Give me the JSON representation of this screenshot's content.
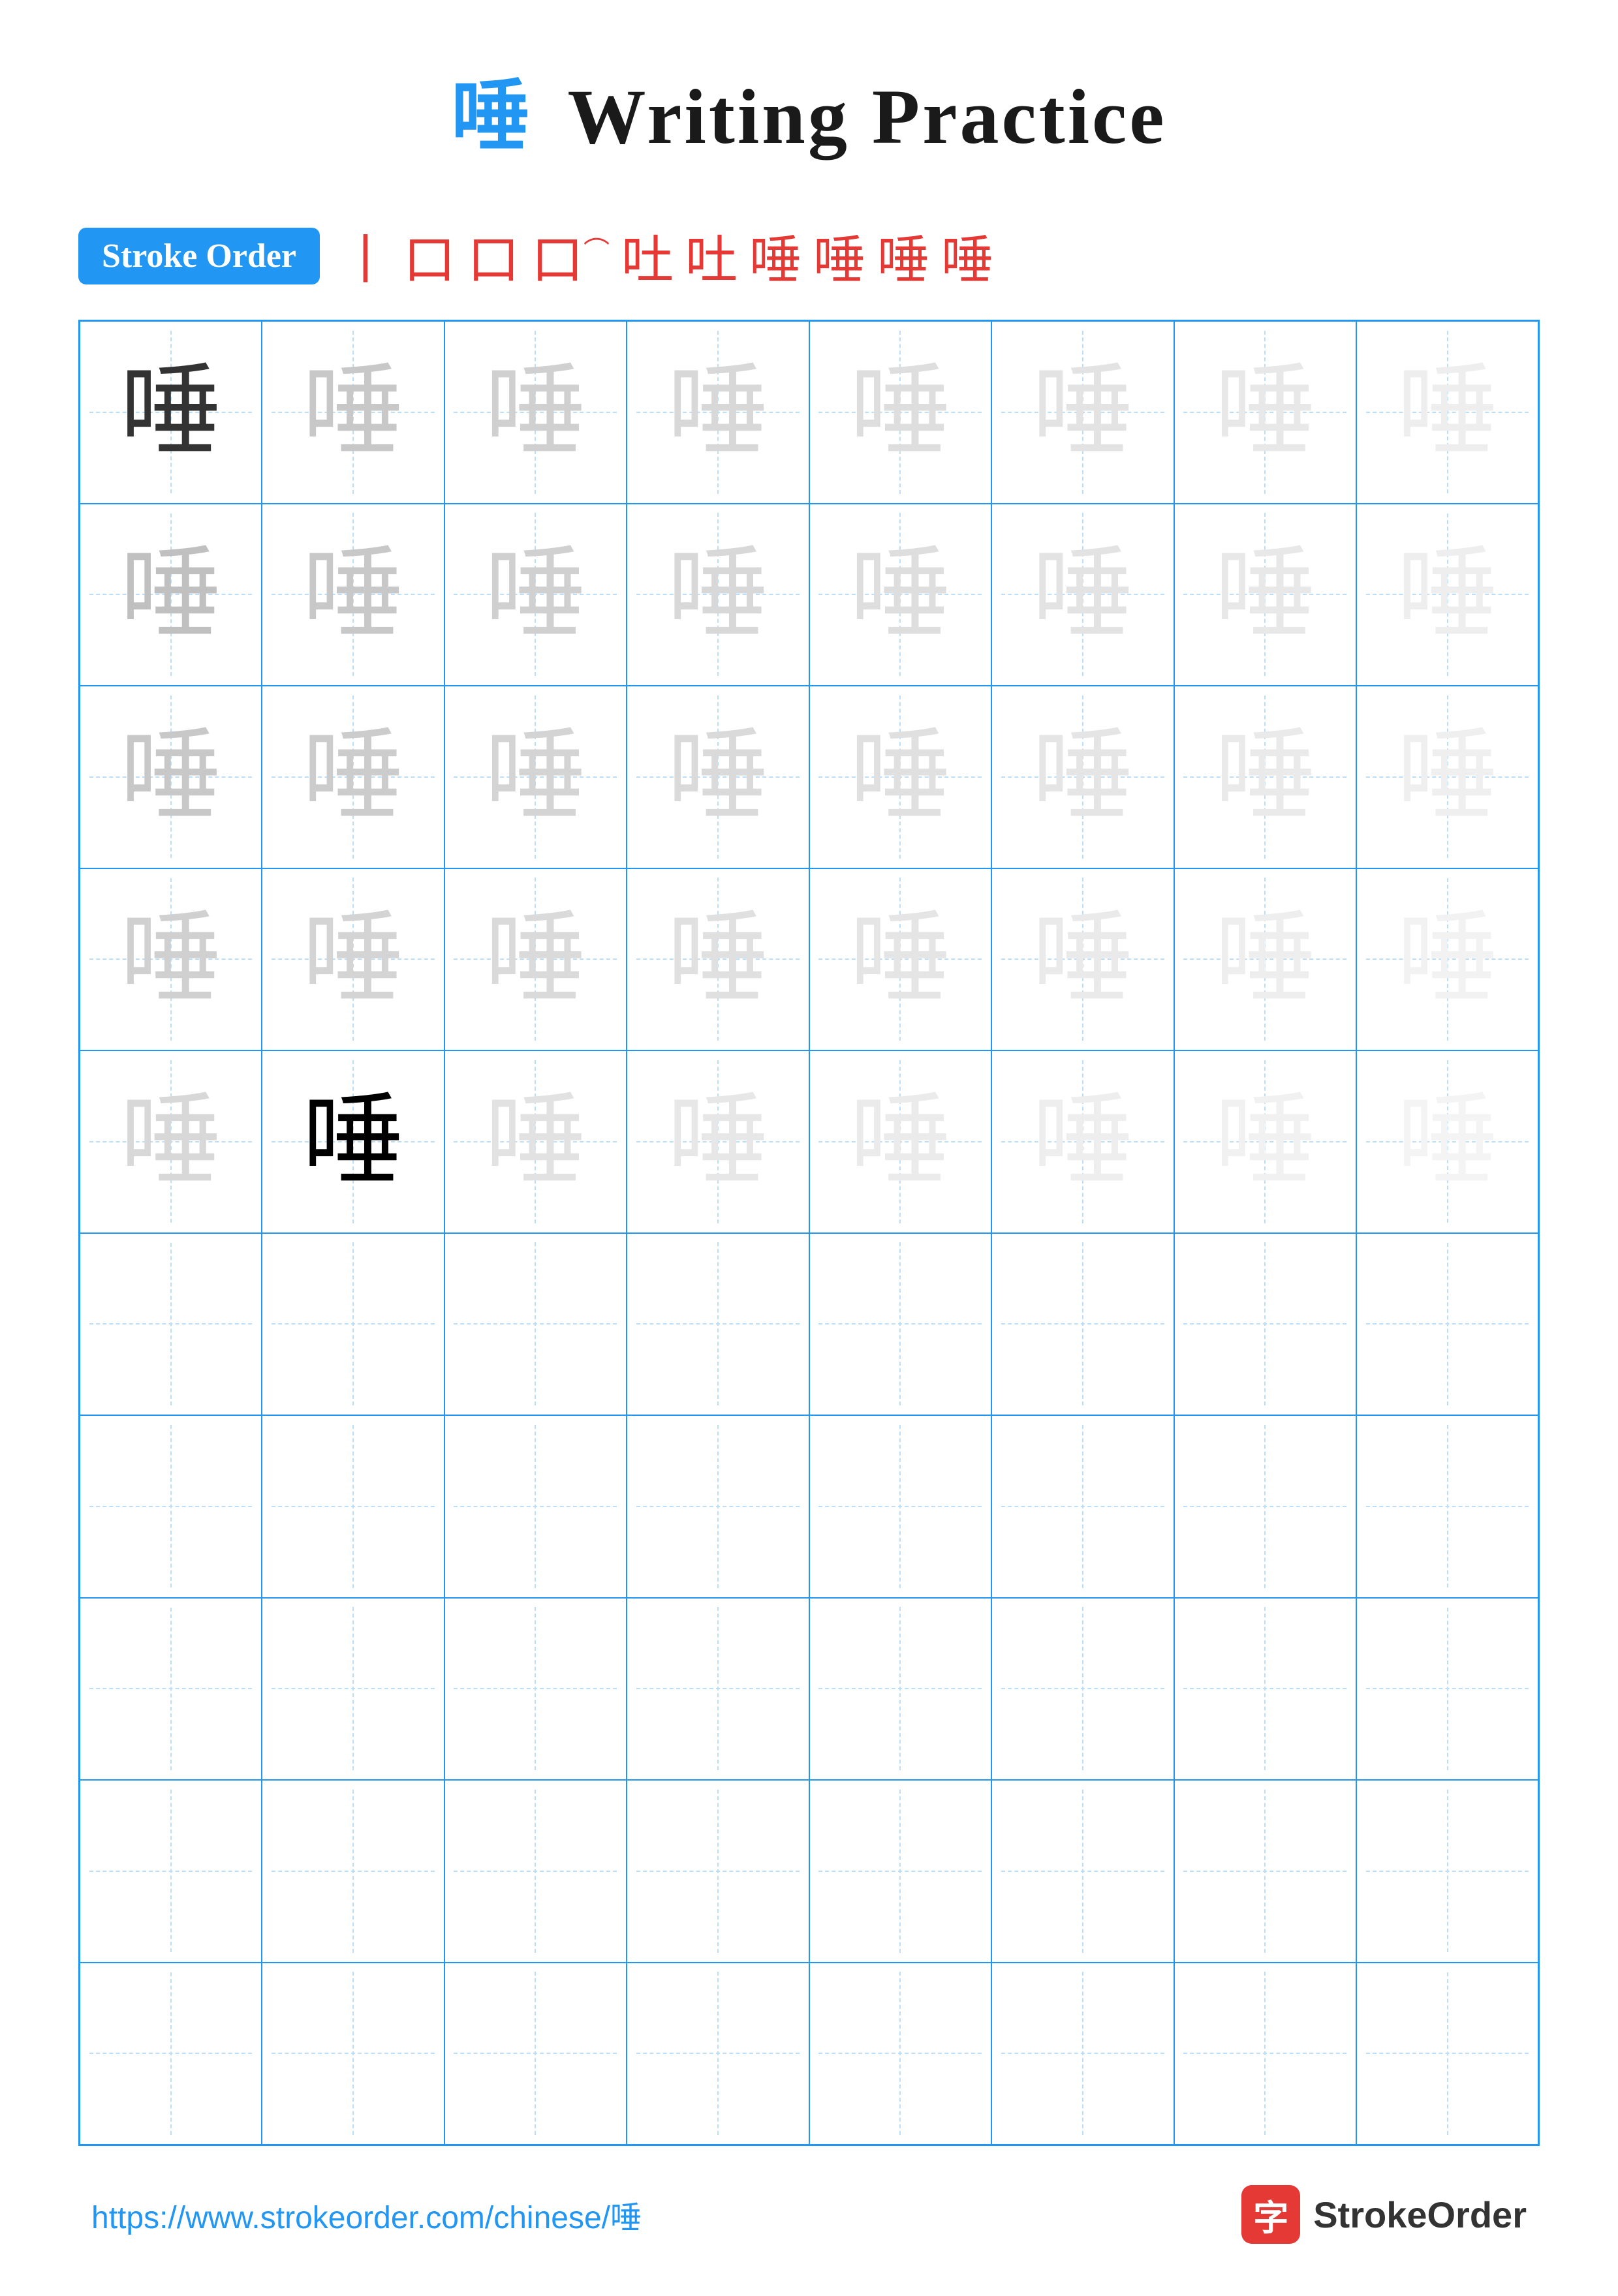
{
  "title": {
    "char": "唾",
    "text": "Writing Practice"
  },
  "stroke_order": {
    "badge_label": "Stroke Order",
    "strokes": [
      "丨",
      "口",
      "口",
      "口⁻",
      "吐",
      "吐",
      "唾",
      "唾",
      "唾",
      "唾"
    ]
  },
  "grid": {
    "cols": 8,
    "rows": 10,
    "char": "唾",
    "filled_rows": 5,
    "guide_rows": 5
  },
  "footer": {
    "url": "https://www.strokeorder.com/chinese/唾",
    "brand_name": "StrokeOrder",
    "brand_char": "字"
  },
  "colors": {
    "blue": "#2196F3",
    "red": "#e53935",
    "dark": "#333333",
    "light1": "#c0c0c0",
    "light2": "#cccccc",
    "light3": "#d8d8d8",
    "light4": "#e4e4e4",
    "faint": "#eeeeee",
    "guide_blue": "#BBDEFB"
  }
}
